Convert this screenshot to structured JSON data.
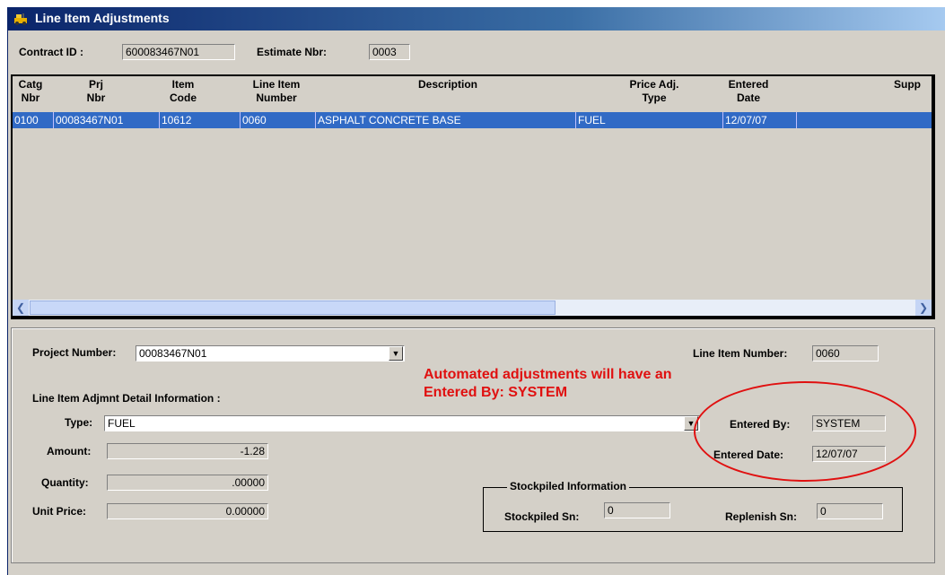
{
  "window": {
    "title": "Line Item Adjustments"
  },
  "header": {
    "contract_label": "Contract ID :",
    "contract_value": "600083467N01",
    "estimate_label": "Estimate Nbr:",
    "estimate_value": "0003"
  },
  "grid": {
    "columns": [
      {
        "line1": "Catg",
        "line2": "Nbr"
      },
      {
        "line1": "Prj",
        "line2": "Nbr"
      },
      {
        "line1": "Item",
        "line2": "Code"
      },
      {
        "line1": "Line Item",
        "line2": "Number"
      },
      {
        "line1": "Description",
        "line2": ""
      },
      {
        "line1": "Price Adj.",
        "line2": "Type"
      },
      {
        "line1": "Entered",
        "line2": "Date"
      },
      {
        "line1": "Supp",
        "line2": ""
      }
    ],
    "rows": [
      [
        "0100",
        "00083467N01",
        "10612",
        "0060",
        "ASPHALT CONCRETE BASE",
        "FUEL",
        "12/07/07",
        ""
      ]
    ]
  },
  "detail": {
    "project_label": "Project Number:",
    "project_value": "00083467N01",
    "line_item_label": "Line Item Number:",
    "line_item_value": "0060",
    "section_label": "Line Item Adjmnt Detail Information :",
    "type_label": "Type:",
    "type_value": "FUEL",
    "amount_label": "Amount:",
    "amount_value": "-1.28",
    "quantity_label": "Quantity:",
    "quantity_value": ".00000",
    "unit_price_label": "Unit Price:",
    "unit_price_value": "0.00000",
    "entered_by_label": "Entered By:",
    "entered_by_value": "SYSTEM",
    "entered_date_label": "Entered Date:",
    "entered_date_value": "12/07/07"
  },
  "stockpiled": {
    "title": "Stockpiled Information",
    "sn_label": "Stockpiled Sn:",
    "sn_value": "0",
    "replenish_label": "Replenish Sn:",
    "replenish_value": "0"
  },
  "annotation": {
    "line1": "Automated adjustments will have an",
    "line2": "Entered By: SYSTEM"
  },
  "colors": {
    "selection": "#316ac5",
    "annotation": "#e01010",
    "window_bg": "#d4d0c8"
  }
}
